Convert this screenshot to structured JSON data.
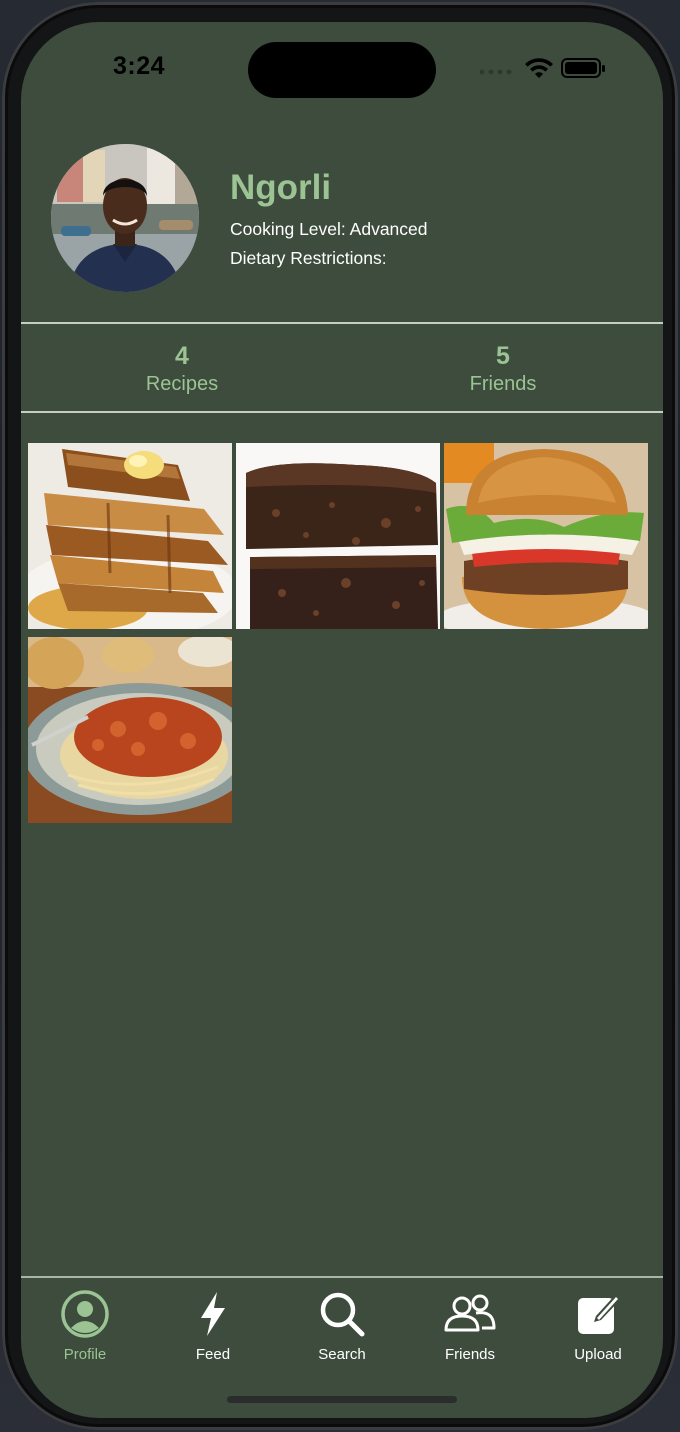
{
  "status_bar": {
    "time": "3:24"
  },
  "profile": {
    "name": "Ngorli",
    "cooking_level": "Cooking Level: Advanced",
    "dietary_restrictions": "Dietary Restrictions:",
    "avatar_icon": "profile-photo"
  },
  "stats": {
    "recipes_count": "4",
    "recipes_label": "Recipes",
    "friends_count": "5",
    "friends_label": "Friends"
  },
  "recipes": [
    {
      "icon": "french-toast-photo"
    },
    {
      "icon": "brownies-photo"
    },
    {
      "icon": "burger-photo"
    },
    {
      "icon": "spaghetti-photo"
    }
  ],
  "tabs": [
    {
      "label": "Profile",
      "icon": "person-circle-icon",
      "active": true
    },
    {
      "label": "Feed",
      "icon": "lightning-bolt-icon",
      "active": false
    },
    {
      "label": "Search",
      "icon": "magnifier-icon",
      "active": false
    },
    {
      "label": "Friends",
      "icon": "people-icon",
      "active": false
    },
    {
      "label": "Upload",
      "icon": "compose-icon",
      "active": false
    }
  ],
  "colors": {
    "background": "#3d4c3c",
    "accent": "#9bc393",
    "text": "#ffffff",
    "divider": "#c6cec4"
  }
}
